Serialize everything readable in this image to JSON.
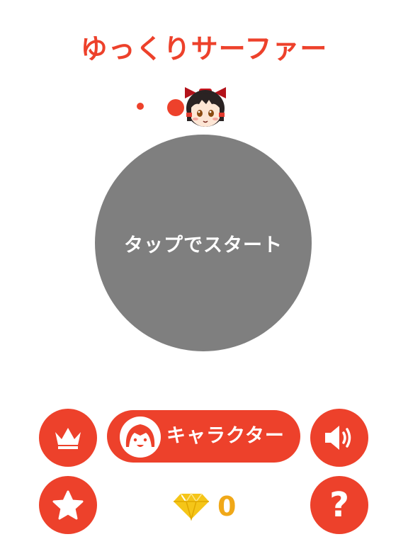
{
  "game": {
    "title": "ゆっくりサーファー",
    "start_label": "タップでスタート"
  },
  "menu": {
    "ranking_icon": "crown-icon",
    "character_label": "キャラクター",
    "sound_icon": "speaker-icon",
    "rate_icon": "star-icon",
    "help_label": "?"
  },
  "currency": {
    "icon": "diamond-icon",
    "count": "0"
  },
  "colors": {
    "accent": "#ed412b",
    "start_circle": "#7f7f7f",
    "gem": "#f5c518",
    "gem_count": "#f0a818"
  }
}
